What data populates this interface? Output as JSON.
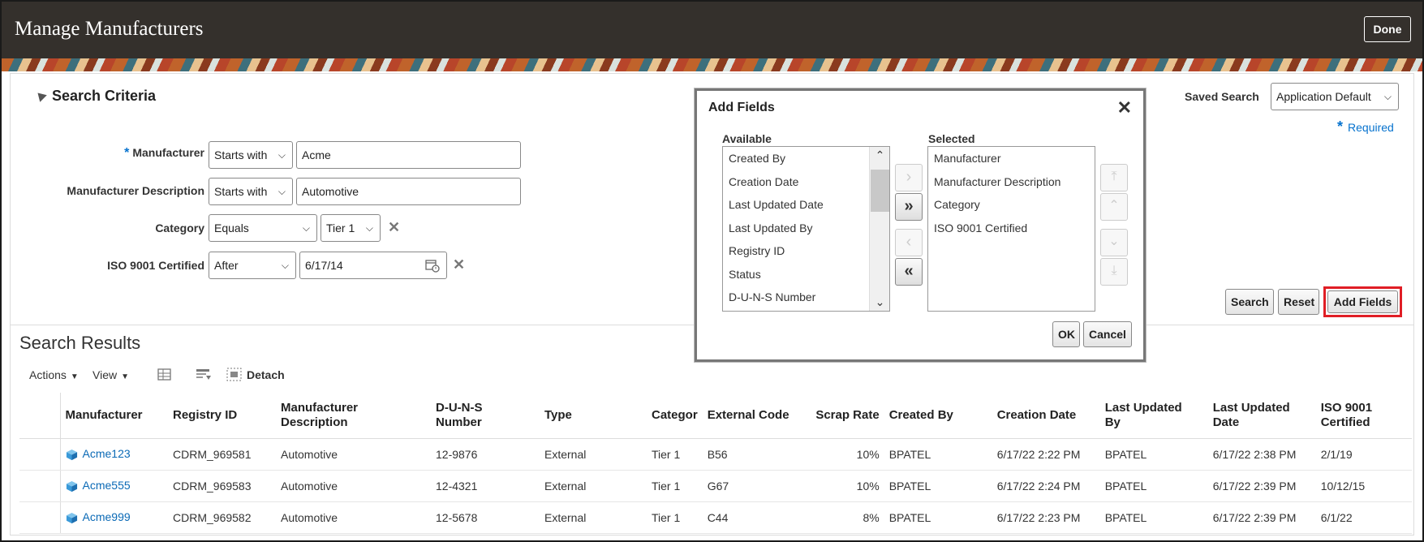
{
  "app": {
    "title": "Manage Manufacturers",
    "done_label": "Done"
  },
  "search": {
    "header": "Search Criteria",
    "saved_search_label": "Saved Search",
    "saved_search_value": "Application Default",
    "required_label": "Required",
    "fields": [
      {
        "label": "Manufacturer",
        "operator": "Starts with",
        "value": "Acme",
        "required": true
      },
      {
        "label": "Manufacturer Description",
        "operator": "Starts with",
        "value": "Automotive"
      },
      {
        "label": "Category",
        "operator": "Equals",
        "value": "Tier 1"
      },
      {
        "label": "ISO 9001 Certified",
        "operator": "After",
        "value": "6/17/14"
      }
    ],
    "buttons": {
      "search": "Search",
      "reset": "Reset",
      "add_fields": "Add Fields"
    }
  },
  "results": {
    "title": "Search Results",
    "toolbar": {
      "actions": "Actions",
      "view": "View",
      "detach": "Detach"
    },
    "columns": [
      "Manufacturer",
      "Registry ID",
      "Manufacturer Description",
      "D-U-N-S Number",
      "Type",
      "Categor",
      "External Code",
      "Scrap Rate",
      "Created By",
      "Creation Date",
      "Last Updated By",
      "Last Updated Date",
      "ISO 9001 Certified"
    ],
    "rows": [
      [
        "Acme123",
        "CDRM_969581",
        "Automotive",
        "12-9876",
        "External",
        "Tier 1",
        "B56",
        "10%",
        "BPATEL",
        "6/17/22 2:22 PM",
        "BPATEL",
        "6/17/22 2:38 PM",
        "2/1/19"
      ],
      [
        "Acme555",
        "CDRM_969583",
        "Automotive",
        "12-4321",
        "External",
        "Tier 1",
        "G67",
        "10%",
        "BPATEL",
        "6/17/22 2:24 PM",
        "BPATEL",
        "6/17/22 2:39 PM",
        "10/12/15"
      ],
      [
        "Acme999",
        "CDRM_969582",
        "Automotive",
        "12-5678",
        "External",
        "Tier 1",
        "C44",
        "8%",
        "BPATEL",
        "6/17/22 2:23 PM",
        "BPATEL",
        "6/17/22 2:39 PM",
        "6/1/22"
      ]
    ]
  },
  "dialog": {
    "title": "Add Fields",
    "available_label": "Available",
    "selected_label": "Selected",
    "available": [
      "Created By",
      "Creation Date",
      "Last Updated Date",
      "Last Updated By",
      "Registry ID",
      "Status",
      "D-U-N-S Number"
    ],
    "selected": [
      "Manufacturer",
      "Manufacturer Description",
      "Category",
      "ISO 9001 Certified"
    ],
    "ok_label": "OK",
    "cancel_label": "Cancel"
  }
}
